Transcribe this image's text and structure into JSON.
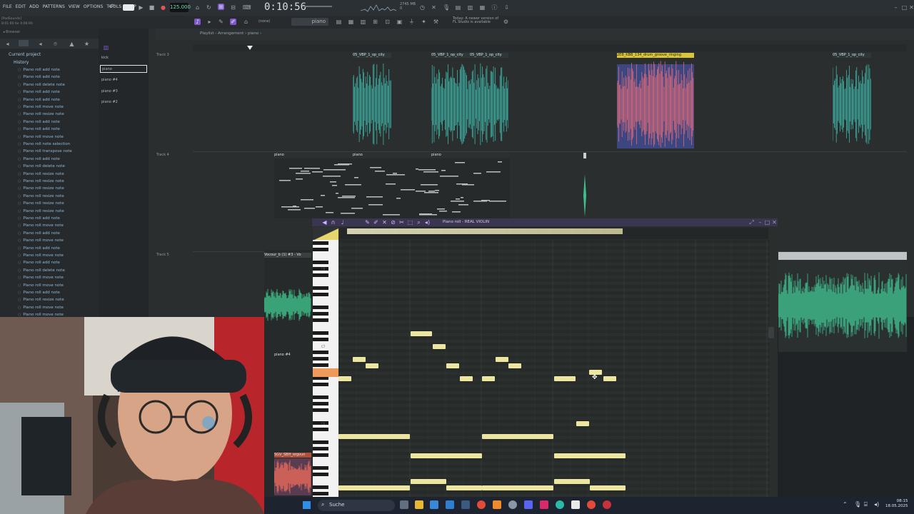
{
  "menu": [
    "FILE",
    "EDIT",
    "ADD",
    "PATTERNS",
    "VIEW",
    "OPTIONS",
    "TOOLS",
    "HELP"
  ],
  "tempo": "125.000",
  "time": "0:10:56",
  "cpu_info": [
    "2745 MB",
    "0"
  ],
  "pattern_name": "piano",
  "news": [
    "Today: A newer version of",
    "FL Studio is available"
  ],
  "hint": {
    "line1": "[PadSounds]",
    "line2": "8:01:00 for 0:06:00"
  },
  "playlist_title": "Playlist - Arrangement › piano ›",
  "browser": {
    "current_project": "Current project",
    "history_label": "History",
    "history": [
      "Piano roll add note",
      "Piano roll add note",
      "Piano roll delete note",
      "Piano roll add note",
      "Piano roll add note",
      "Piano roll move note",
      "Piano roll resize note",
      "Piano roll add note",
      "Piano roll add note",
      "Piano roll move note",
      "Piano roll note selection",
      "Piano roll transpose note",
      "Piano roll add note",
      "Piano roll delete note",
      "Piano roll resize note",
      "Piano roll resize note",
      "Piano roll resize note",
      "Piano roll resize note",
      "Piano roll resize note",
      "Piano roll resize note",
      "Piano roll add note",
      "Piano roll move note",
      "Piano roll add note",
      "Piano roll move note",
      "Piano roll add note",
      "Piano roll move note",
      "Piano roll add note",
      "Piano roll delete note",
      "Piano roll move note",
      "Piano roll move note",
      "Piano roll add note",
      "Piano roll resize note",
      "Piano roll move note",
      "Piano roll move note",
      "Piano roll add note"
    ]
  },
  "channels": [
    "kick",
    "piano",
    "piano #4",
    "piano #3",
    "piano #2"
  ],
  "tracks": [
    "Track 3",
    "Track 4",
    "Track 5"
  ],
  "clips": {
    "top": [
      "05_VBP_1_op_city",
      "05_VBP_1_op_city",
      "05_VBP_1_op_city",
      "2EB_KBB_134_drum_groove_ringing",
      "05_VBP_1_op_city"
    ],
    "piano": [
      "piano",
      "piano",
      "piano"
    ],
    "vocal": "Vocour_b (1) #3 - Vo",
    "mini_piano": "piano #4",
    "mini_sample": "SGV_SBH_orgoun"
  },
  "pianoroll": {
    "title": "Piano roll - REAL VIOLIN",
    "key_labels": [
      "C8",
      "C7",
      "C6"
    ]
  },
  "taskbar": {
    "search": "Suche",
    "time": "08:15",
    "date": "18.05.2025"
  },
  "colors": {
    "accent": "#7b5ac7",
    "wave": "#3fb5a8",
    "note": "#ece6a1"
  }
}
